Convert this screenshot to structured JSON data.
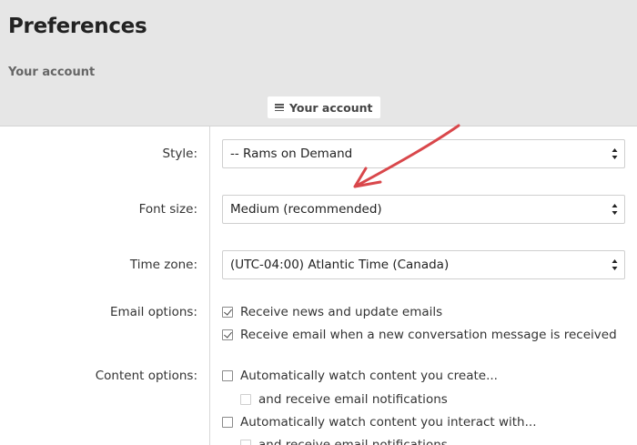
{
  "header": {
    "title": "Preferences",
    "breadcrumb": "Your account",
    "tab_label": "Your account"
  },
  "form": {
    "style": {
      "label": "Style:",
      "value": "-- Rams on Demand"
    },
    "font_size": {
      "label": "Font size:",
      "value": "Medium (recommended)"
    },
    "time_zone": {
      "label": "Time zone:",
      "value": "(UTC-04:00) Atlantic Time (Canada)"
    },
    "email_options": {
      "label": "Email options:",
      "items": [
        {
          "label": "Receive news and update emails",
          "checked": true
        },
        {
          "label": "Receive email when a new conversation message is received",
          "checked": true
        }
      ]
    },
    "content_options": {
      "label": "Content options:",
      "items": [
        {
          "label": "Automatically watch content you create...",
          "checked": false
        },
        {
          "label": "and receive email notifications",
          "checked": false
        },
        {
          "label": "Automatically watch content you interact with...",
          "checked": false
        },
        {
          "label": "and receive email notifications",
          "checked": false
        }
      ]
    }
  },
  "annotation": {
    "arrow_color": "#d9474b"
  }
}
